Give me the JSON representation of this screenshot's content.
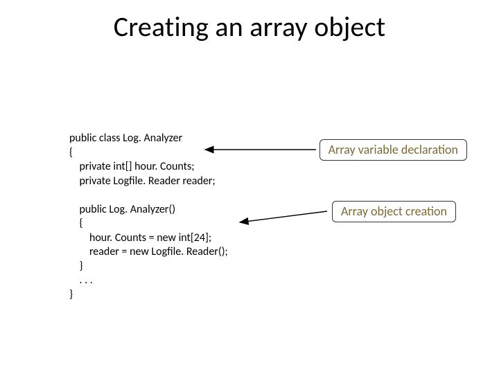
{
  "title": "Creating an array object",
  "code": {
    "l0": "public class Log. Analyzer",
    "l1": "{",
    "l2": "    private int[] hour. Counts;",
    "l3": "    private Logfile. Reader reader;",
    "l4_blank": "",
    "l5": "    public Log. Analyzer()",
    "l6": "    {",
    "l7": "        hour. Counts = new int[24];",
    "l8": "        reader = new Logfile. Reader();",
    "l9": "    }",
    "l10": "    . . .",
    "l11": "}"
  },
  "callouts": {
    "declaration": "Array variable declaration",
    "creation": "Array object creation"
  }
}
